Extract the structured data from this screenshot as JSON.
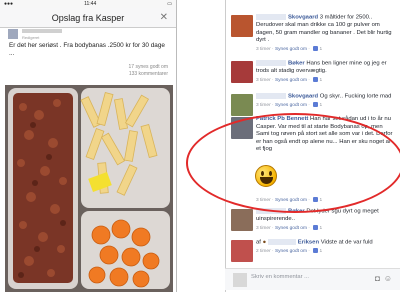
{
  "left_phone": {
    "status_time": "11:44",
    "nav_title": "Opslag fra Kasper",
    "close_icon": "close-icon",
    "post_sub": "Redigeret",
    "post_text": "Er det her seriøst . Fra bodybanas .2500 kr for 30 dage ...",
    "likes_line": "17 synes godt om",
    "comments_line": "133 kommentarer"
  },
  "comments": [
    {
      "name": "Skovgaard",
      "text": "3 måltider for 2500.. Derudover skal man drikke ca 100 gr pulver om dagen, 50 gram mandler og bananer . Det blir hurtig dyrt .",
      "time": "3 timer",
      "like": "Synes godt om",
      "count": "1"
    },
    {
      "name": "Bøker",
      "text": "Hans ben ligner mine og jeg er trods alt stadig overvægtig.",
      "time": "3 timer",
      "like": "Synes godt om",
      "count": "1"
    },
    {
      "name": "Skovgaard",
      "text": "Og skyr.. Fucking lorte mad",
      "time": "3 timer",
      "like": "Synes godt om",
      "count": "1"
    },
    {
      "name": "Patrick Pb Bennett",
      "text": "Han har set sådan ud i to år nu Casper. Var med til at starte Bodybanas op, men Sami tog røven på stort set alle som var i det. Derfor er han også endt op alene nu... Han er sku noget af et fjog",
      "time": "",
      "like": "",
      "count": ""
    },
    {
      "name": "Bøker",
      "text": "Det lyder sgu dyrt og meget uinspirerende..",
      "time": "3 timer",
      "like": "Synes godt om",
      "count": "1"
    },
    {
      "name": "Eriksen",
      "text": "Vidste at de var fuld",
      "time": "2 timer",
      "like": "Synes godt om",
      "count": "1"
    }
  ],
  "poop_prefix": "af",
  "write_placeholder": "Skriv en kommentar ...",
  "colors": {
    "link": "#3b5998",
    "highlight_ring": "#e22a2a"
  }
}
